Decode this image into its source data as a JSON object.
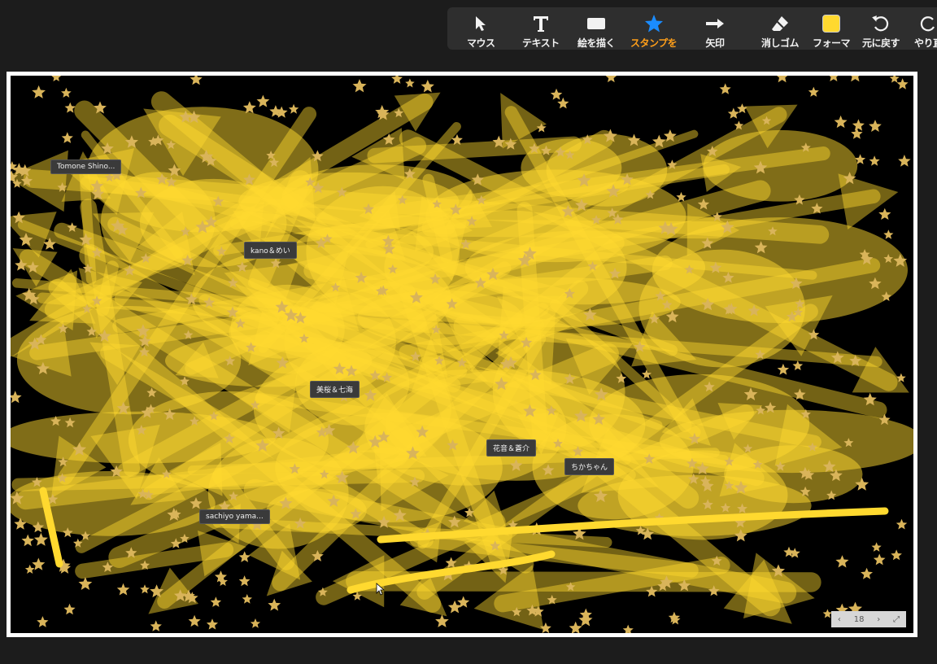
{
  "toolbar": {
    "items": [
      {
        "label": "マウス",
        "icon": "pointer-arrow-icon",
        "active": false
      },
      {
        "label": "テキスト",
        "icon": "text-t-icon",
        "active": false
      },
      {
        "label": "絵を描く",
        "icon": "draw-rectangle-icon",
        "active": false
      },
      {
        "label": "スタンプを",
        "icon": "star-stamp-icon",
        "active": true
      },
      {
        "label": "矢印",
        "icon": "arrow-right-icon",
        "active": false
      },
      {
        "label": "消しゴム",
        "icon": "eraser-icon",
        "active": false
      },
      {
        "label": "フォーマ",
        "icon": "format-color-swatch-icon",
        "active": false
      },
      {
        "label": "元に戻す",
        "icon": "undo-icon",
        "active": false
      },
      {
        "label": "やり直",
        "icon": "redo-icon",
        "active": false
      }
    ],
    "active_color": "#ff9f1a",
    "format_swatch_color": "#ffd92f"
  },
  "board": {
    "background": "#000000",
    "stroke_color": "#ffd92f",
    "stamp_color": "#d9b45a",
    "name_tags": [
      {
        "text": "Tomone Shino..."
      },
      {
        "text": "kano＆めい"
      },
      {
        "text": "美桜＆七海"
      },
      {
        "text": "花音＆蒼介"
      },
      {
        "text": "ちかちゃん"
      },
      {
        "text": "sachiyo yama..."
      }
    ]
  },
  "pager": {
    "prev": "‹",
    "page": "18",
    "next": "›"
  }
}
